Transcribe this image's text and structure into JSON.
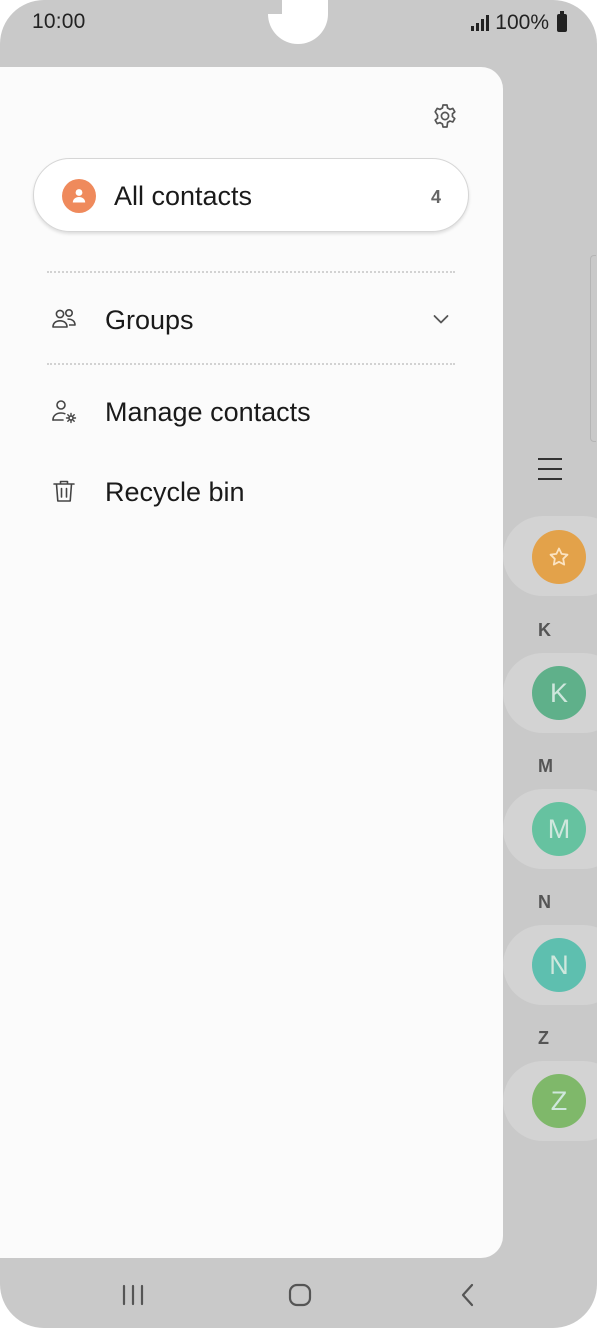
{
  "status_bar": {
    "time": "10:00",
    "battery": "100%"
  },
  "drawer": {
    "all_contacts": {
      "label": "All contacts",
      "count": "4"
    },
    "items": [
      {
        "label": "Groups",
        "icon": "groups-icon"
      },
      {
        "label": "Manage contacts",
        "icon": "manage-contacts-icon"
      },
      {
        "label": "Recycle bin",
        "icon": "trash-icon"
      }
    ]
  },
  "background_list": {
    "sections": [
      {
        "letter": "K",
        "avatar": "K",
        "color": "#5fb08a"
      },
      {
        "letter": "M",
        "avatar": "M",
        "color": "#66c2a0"
      },
      {
        "letter": "N",
        "avatar": "N",
        "color": "#5ebfaf"
      },
      {
        "letter": "Z",
        "avatar": "Z",
        "color": "#7fb86a"
      }
    ],
    "favorites_color": "#e3a24a"
  },
  "colors": {
    "accent_orange": "#ef8a5c",
    "overlay_grey": "#c9c9c9"
  }
}
